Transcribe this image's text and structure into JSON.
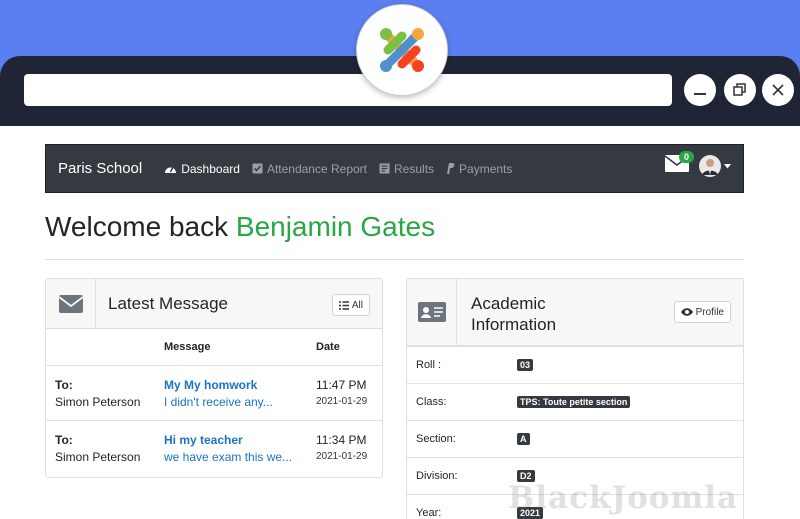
{
  "browser": {
    "minimize_icon": "minimize-icon",
    "restore_icon": "restore-icon",
    "close_icon": "close-icon"
  },
  "navbar": {
    "brand": "Paris School",
    "items": [
      {
        "label": "Dashboard",
        "icon": "dashboard-icon",
        "active": true
      },
      {
        "label": "Attendance Report",
        "icon": "checkbox-icon",
        "active": false
      },
      {
        "label": "Results",
        "icon": "results-icon",
        "active": false
      },
      {
        "label": "Payments",
        "icon": "paypal-icon",
        "active": false
      }
    ],
    "message_count": "0"
  },
  "welcome": {
    "text": "Welcome back",
    "name": "Benjamin Gates"
  },
  "messages_card": {
    "title": "Latest Message",
    "all_button": "All",
    "columns": [
      "Message",
      "Date"
    ],
    "rows": [
      {
        "to_label": "To:",
        "to_name": "Simon Peterson",
        "subject": "My My homwork",
        "preview": "I didn't receive any...",
        "time": "11:47 PM",
        "date": "2021-01-29"
      },
      {
        "to_label": "To:",
        "to_name": "Simon Peterson",
        "subject": "Hi my teacher",
        "preview": "we have exam this we...",
        "time": "11:34 PM",
        "date": "2021-01-29"
      }
    ]
  },
  "academic_card": {
    "title_line1": "Academic",
    "title_line2": "Information",
    "profile_button": "Profile",
    "rows": [
      {
        "label": "Roll :",
        "value": "03"
      },
      {
        "label": "Class:",
        "value": "TPS: Toute petite section"
      },
      {
        "label": "Section:",
        "value": "A"
      },
      {
        "label": "Division:",
        "value": "D2"
      },
      {
        "label": "Year:",
        "value": "2021"
      }
    ]
  },
  "colors": {
    "background": "#5b7ff0",
    "navbar": "#343a40",
    "accent_green": "#28a745",
    "link_blue": "#1a73c8"
  }
}
